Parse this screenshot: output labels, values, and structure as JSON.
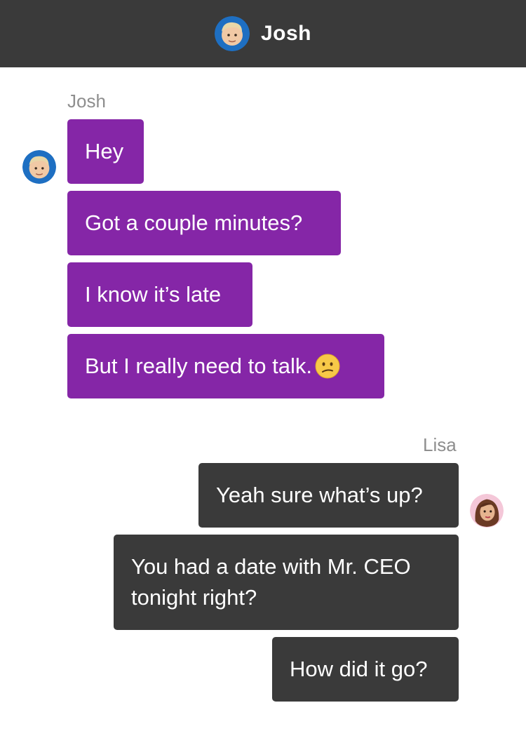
{
  "header": {
    "title": "Josh",
    "avatar_icon": "josh-avatar"
  },
  "conversation": {
    "josh": {
      "name": "Josh",
      "messages": [
        {
          "text": "Hey"
        },
        {
          "text": "Got a couple minutes?"
        },
        {
          "text": "I know it’s late"
        },
        {
          "text": "But I really need to talk.",
          "emoji": "confused-face-emoji"
        }
      ]
    },
    "lisa": {
      "name": "Lisa",
      "messages": [
        {
          "text": "Yeah sure what’s up?"
        },
        {
          "text": "You had a date with Mr. CEO tonight right?"
        },
        {
          "text": "How did it go?"
        }
      ]
    }
  },
  "colors": {
    "header_bg": "#3a3a3a",
    "josh_bubble": "#8526a7",
    "lisa_bubble": "#3a3a3a",
    "label_gray": "#8e8e8e"
  }
}
